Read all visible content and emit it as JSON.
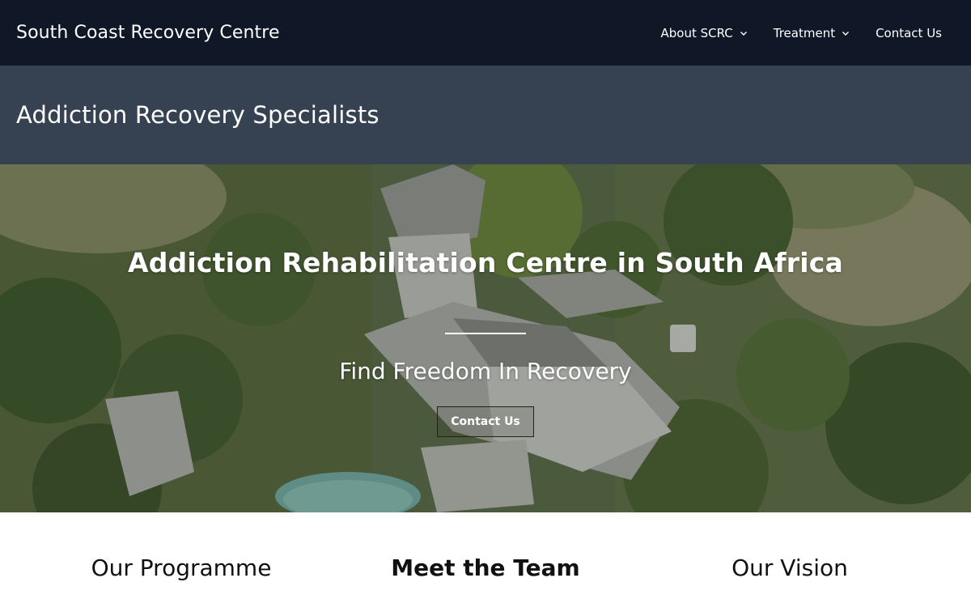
{
  "header": {
    "brand": "South Coast Recovery Centre",
    "nav": [
      {
        "label": "About SCRC",
        "icon": "chevron-down-icon"
      },
      {
        "label": "Treatment",
        "icon": "chevron-down-icon"
      },
      {
        "label": "Contact Us"
      }
    ]
  },
  "subheader": {
    "title": "Addiction Recovery Specialists"
  },
  "hero": {
    "title": "Addiction Rehabilitation Centre in South Africa",
    "subtitle": "Find Freedom In Recovery",
    "button": "Contact Us"
  },
  "sections": [
    {
      "title": "Our Programme"
    },
    {
      "title": "Meet the Team"
    },
    {
      "title": "Our Vision"
    }
  ],
  "colors": {
    "topbar": "#101828",
    "subheader": "#364152",
    "text_light": "#ffffff"
  }
}
